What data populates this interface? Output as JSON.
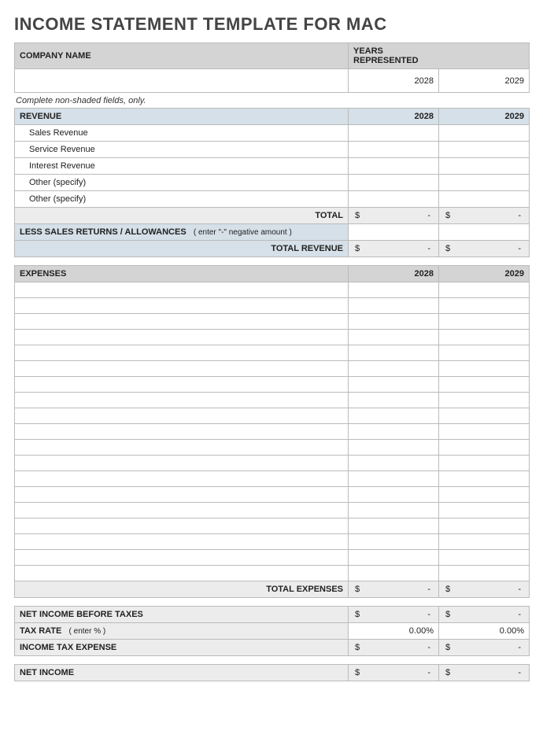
{
  "title": "INCOME STATEMENT TEMPLATE FOR MAC",
  "companyHeader": "COMPANY NAME",
  "yearsHeader": "YEARS REPRESENTED",
  "year1": "2028",
  "year2": "2029",
  "instruction": "Complete non-shaded fields, only.",
  "revenue": {
    "header": "REVENUE",
    "items": [
      "Sales Revenue",
      "Service Revenue",
      "Interest Revenue",
      "Other (specify)",
      "Other (specify)"
    ],
    "totalLabel": "TOTAL",
    "lessReturnsLabel": "LESS SALES RETURNS / ALLOWANCES",
    "lessReturnsHint": "( enter \"-\" negative amount )",
    "totalRevenueLabel": "TOTAL REVENUE"
  },
  "expenses": {
    "header": "EXPENSES",
    "blankRows": 19,
    "totalLabel": "TOTAL EXPENSES"
  },
  "summary": {
    "netBeforeTaxLabel": "NET INCOME BEFORE TAXES",
    "taxRateLabel": "TAX RATE",
    "taxRateHint": "( enter % )",
    "taxRateValue": "0.00%",
    "incomeTaxExpenseLabel": "INCOME TAX EXPENSE",
    "netIncomeLabel": "NET INCOME"
  },
  "moneyPlaceholder": {
    "sym": "$",
    "dash": "-"
  }
}
